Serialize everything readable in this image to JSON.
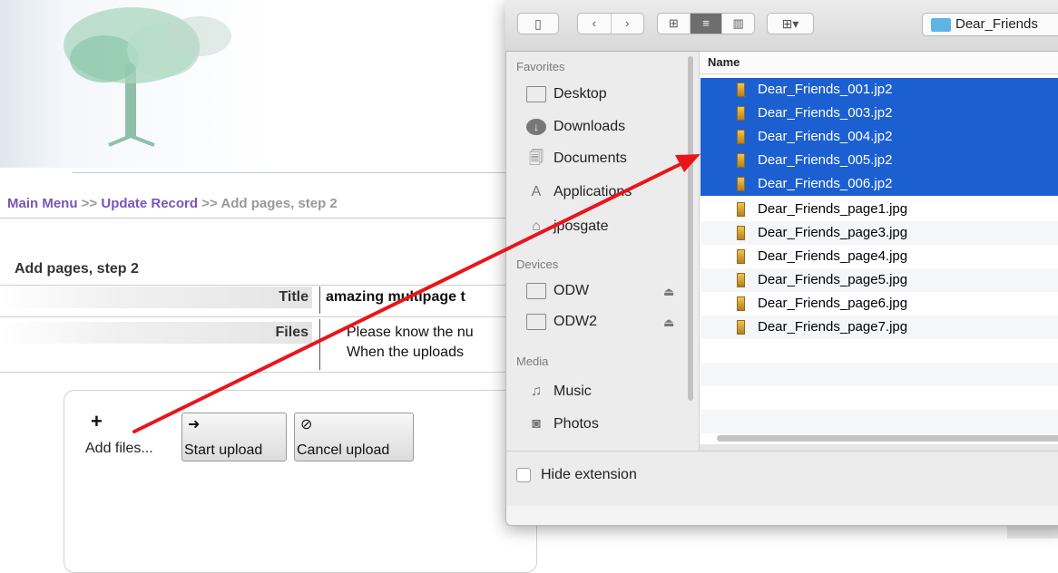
{
  "page": {
    "breadcrumb": {
      "main_menu": "Main Menu",
      "sep1": ">>",
      "update_record": "Update Record",
      "sep2": ">>",
      "current": "Add pages, step 2"
    },
    "section_title": "Add pages, step 2",
    "fields": {
      "title_label": "Title",
      "title_value": "amazing multipage t",
      "files_label": "Files",
      "files_line1": "Please know the nu",
      "files_line2": "When the uploads"
    },
    "upload": {
      "add_icon": "plus-icon",
      "add_label": "Add files...",
      "start_icon": "arrow-circle-right-icon",
      "start_label": "Start upload",
      "cancel_icon": "ban-icon",
      "cancel_label": "Cancel upload"
    }
  },
  "dialog": {
    "path_folder": "Dear_Friends",
    "sidebar": {
      "favorites_header": "Favorites",
      "favorites": [
        {
          "label": "Desktop",
          "icon": "desktop-icon"
        },
        {
          "label": "Downloads",
          "icon": "downloads-icon"
        },
        {
          "label": "Documents",
          "icon": "documents-icon"
        },
        {
          "label": "Applications",
          "icon": "applications-icon"
        },
        {
          "label": "jposgate",
          "icon": "home-icon"
        }
      ],
      "devices_header": "Devices",
      "devices": [
        {
          "label": "ODW",
          "icon": "drive-icon"
        },
        {
          "label": "ODW2",
          "icon": "drive-icon"
        }
      ],
      "media_header": "Media",
      "media": [
        {
          "label": "Music",
          "icon": "music-icon"
        },
        {
          "label": "Photos",
          "icon": "photos-icon"
        }
      ]
    },
    "column_header": "Name",
    "files": [
      {
        "name": "Dear_Friends_001.jp2",
        "selected": true
      },
      {
        "name": "Dear_Friends_003.jp2",
        "selected": true
      },
      {
        "name": "Dear_Friends_004.jp2",
        "selected": true
      },
      {
        "name": "Dear_Friends_005.jp2",
        "selected": true
      },
      {
        "name": "Dear_Friends_006.jp2",
        "selected": true
      },
      {
        "name": "Dear_Friends_page1.jpg",
        "selected": false
      },
      {
        "name": "Dear_Friends_page3.jpg",
        "selected": false
      },
      {
        "name": "Dear_Friends_page4.jpg",
        "selected": false
      },
      {
        "name": "Dear_Friends_page5.jpg",
        "selected": false
      },
      {
        "name": "Dear_Friends_page6.jpg",
        "selected": false
      },
      {
        "name": "Dear_Friends_page7.jpg",
        "selected": false
      }
    ],
    "hide_extension_label": "Hide extension",
    "hide_extension_checked": false
  },
  "colors": {
    "selection": "#1c5fd1",
    "link_purple": "#7a55b8",
    "arrow_red": "#e8161b"
  }
}
